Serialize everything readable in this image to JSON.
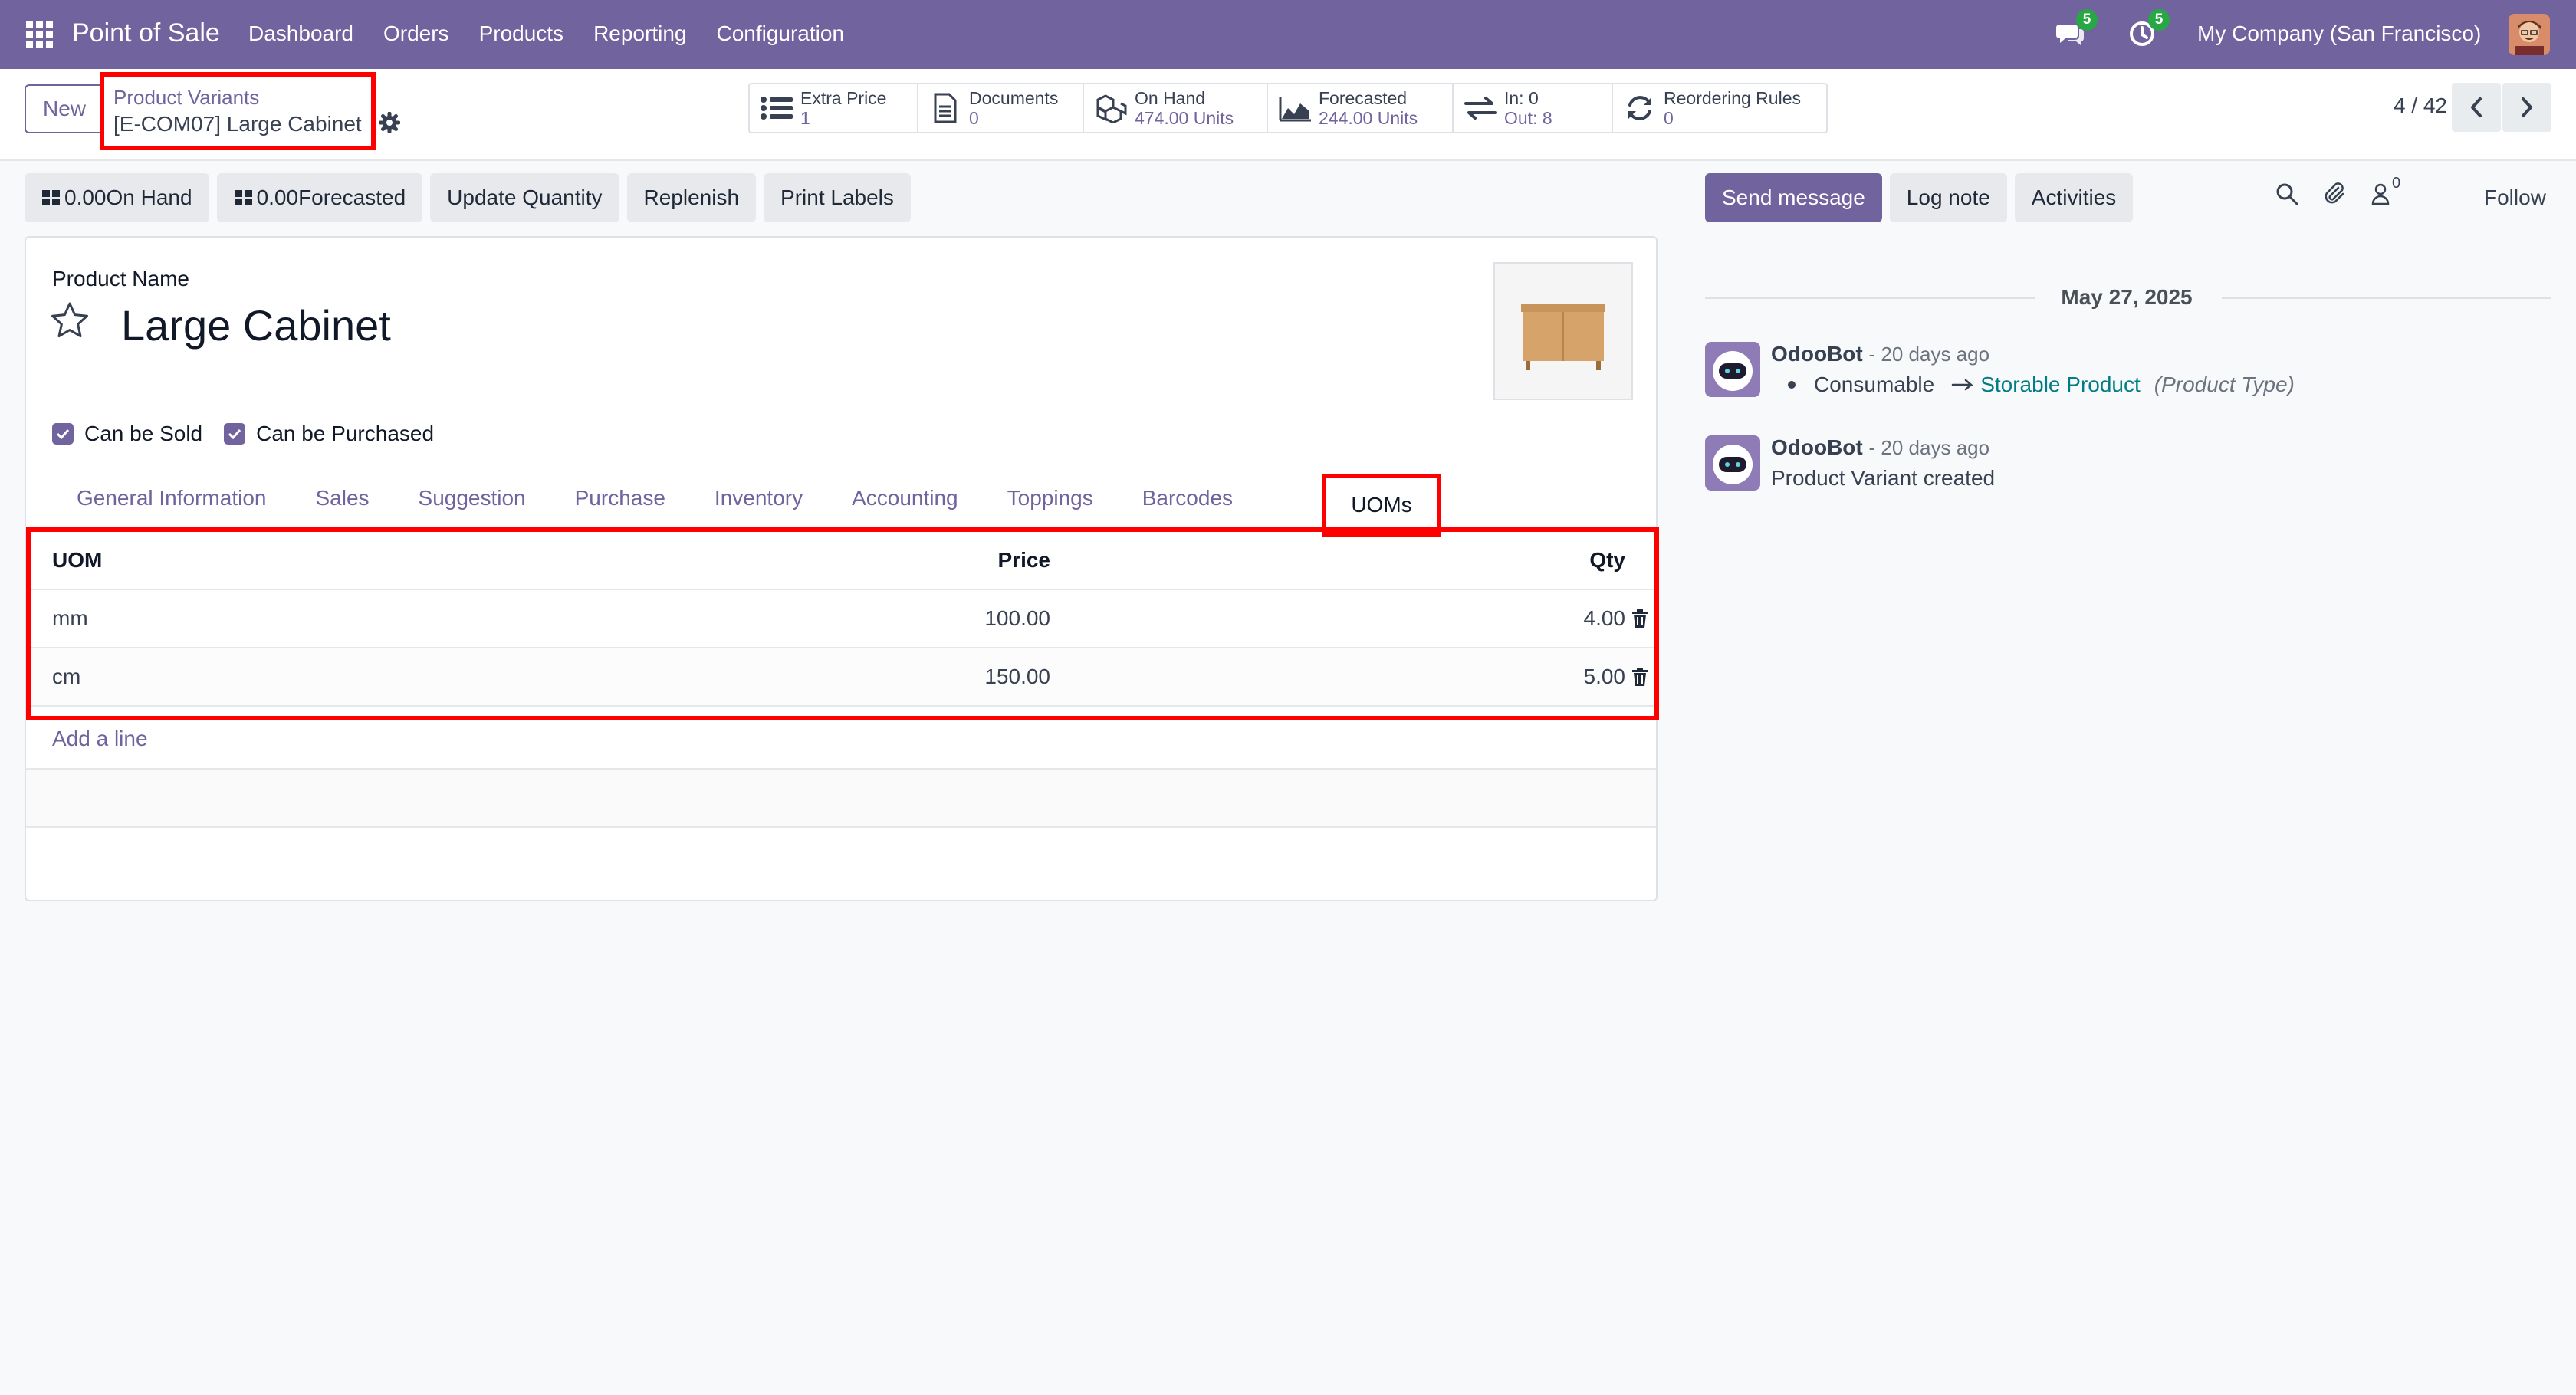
{
  "app": {
    "name": "Point of Sale",
    "menu": [
      "Dashboard",
      "Orders",
      "Products",
      "Reporting",
      "Configuration"
    ],
    "messages_badge": "5",
    "activities_badge": "5",
    "company": "My Company (San Francisco)"
  },
  "control_panel": {
    "new_label": "New",
    "breadcrumb_parent": "Product Variants",
    "breadcrumb_current": "[E-COM07] Large Cabinet",
    "smart_buttons": [
      {
        "icon": "list-icon",
        "label": "Extra Price",
        "value": "1"
      },
      {
        "icon": "document-icon",
        "label": "Documents",
        "value": "0"
      },
      {
        "icon": "cubes-icon",
        "label": "On Hand",
        "value": "474.00 Units"
      },
      {
        "icon": "area-chart-icon",
        "label": "Forecasted",
        "value": "244.00 Units"
      },
      {
        "icon": "exchange-icon",
        "label": "In: 0",
        "value": "Out: 8"
      },
      {
        "icon": "refresh-icon",
        "label": "Reordering Rules",
        "value": "0"
      }
    ],
    "pager": "4 / 42"
  },
  "statusbar": {
    "on_hand": "0.00On Hand",
    "forecasted": "0.00Forecasted",
    "update_quantity": "Update Quantity",
    "replenish": "Replenish",
    "print_labels": "Print Labels"
  },
  "form": {
    "product_name_label": "Product Name",
    "product_name": "Large Cabinet",
    "can_be_sold": "Can be Sold",
    "can_be_purchased": "Can be Purchased",
    "tabs": [
      "General Information",
      "Sales",
      "Suggestion",
      "Purchase",
      "Inventory",
      "Accounting",
      "Toppings",
      "Barcodes"
    ],
    "active_tab": "UOMs",
    "uom_table": {
      "headers": {
        "uom": "UOM",
        "price": "Price",
        "qty": "Qty"
      },
      "rows": [
        {
          "uom": "mm",
          "price": "100.00",
          "qty": "4.00"
        },
        {
          "uom": "cm",
          "price": "150.00",
          "qty": "5.00"
        }
      ],
      "add_line": "Add a line"
    }
  },
  "chatter": {
    "send_message": "Send message",
    "log_note": "Log note",
    "activities": "Activities",
    "followers_count": "0",
    "follow": "Follow",
    "date": "May 27, 2025",
    "messages": [
      {
        "author": "OdooBot",
        "ago": "- 20 days ago",
        "old_value": "Consumable",
        "new_value": "Storable Product",
        "field": "(Product Type)"
      },
      {
        "author": "OdooBot",
        "ago": "- 20 days ago",
        "body": "Product Variant created"
      }
    ]
  },
  "colors": {
    "brand": "#71639e",
    "highlight": "#ff0000",
    "badge": "#28a745",
    "tracking_value": "#017e84"
  }
}
